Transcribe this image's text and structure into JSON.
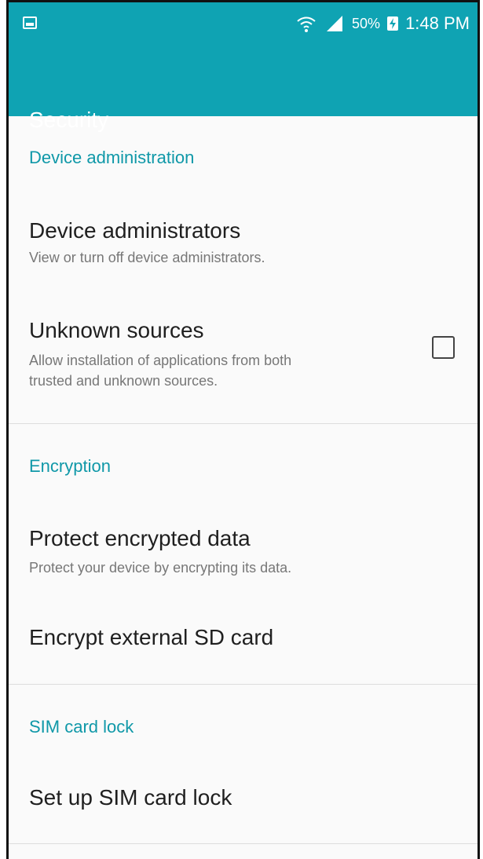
{
  "status_bar": {
    "battery": "50%",
    "time": "1:48 PM",
    "icons": [
      "image-icon",
      "wifi-icon",
      "signal-icon",
      "charging-icon"
    ]
  },
  "app_bar": {
    "title": "Security",
    "color": "#0fa3b3"
  },
  "sections": [
    {
      "header": "Device administration",
      "items": [
        {
          "title": "Device administrators",
          "subtitle": "View or turn off device administrators."
        },
        {
          "title": "Unknown sources",
          "subtitle_line1": "Allow installation of applications from both",
          "subtitle_line2": "trusted and unknown sources.",
          "checkbox_checked": false
        }
      ]
    },
    {
      "header": "Encryption",
      "items": [
        {
          "title": "Protect encrypted data",
          "subtitle": "Protect your device by encrypting its data."
        },
        {
          "title": "Encrypt external SD card"
        }
      ]
    },
    {
      "header": "SIM card lock",
      "items": [
        {
          "title": "Set up SIM card lock"
        }
      ]
    }
  ],
  "colors": {
    "accent": "#0fa3b3",
    "section_header": "#0f98a8",
    "primary_text": "#1f1f1f",
    "secondary_text": "#777777"
  }
}
